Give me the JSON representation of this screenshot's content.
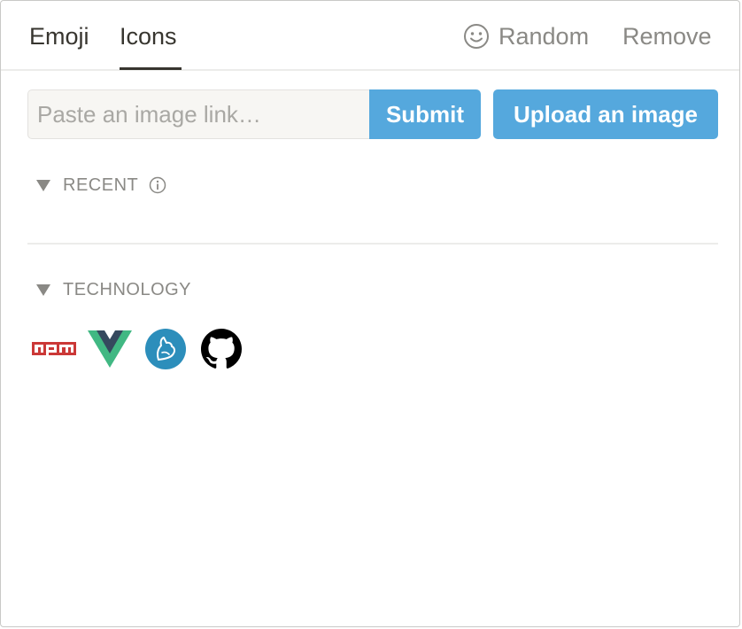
{
  "tabs": {
    "emoji_label": "Emoji",
    "icons_label": "Icons",
    "active": "Icons"
  },
  "actions": {
    "random_label": "Random",
    "remove_label": "Remove",
    "random_icon": "smiley-face-icon"
  },
  "link": {
    "placeholder": "Paste an image link…",
    "value": "",
    "submit_label": "Submit",
    "upload_label": "Upload an image"
  },
  "sections": {
    "recent": {
      "title": "RECENT",
      "caret_icon": "caret-down-icon",
      "info_icon": "info-icon",
      "items": []
    },
    "technology": {
      "title": "TECHNOLOGY",
      "caret_icon": "caret-down-icon",
      "items": [
        {
          "name": "npm",
          "icon": "npm-icon",
          "color": "#cb3837"
        },
        {
          "name": "vue",
          "icon": "vue-icon",
          "color": "#41b883"
        },
        {
          "name": "yarn",
          "icon": "yarn-icon",
          "color": "#2c8ebb"
        },
        {
          "name": "github",
          "icon": "github-icon",
          "color": "#000000"
        }
      ]
    }
  },
  "colors": {
    "accent": "#55a8dd",
    "text": "#37352f",
    "muted": "#8a8985"
  }
}
